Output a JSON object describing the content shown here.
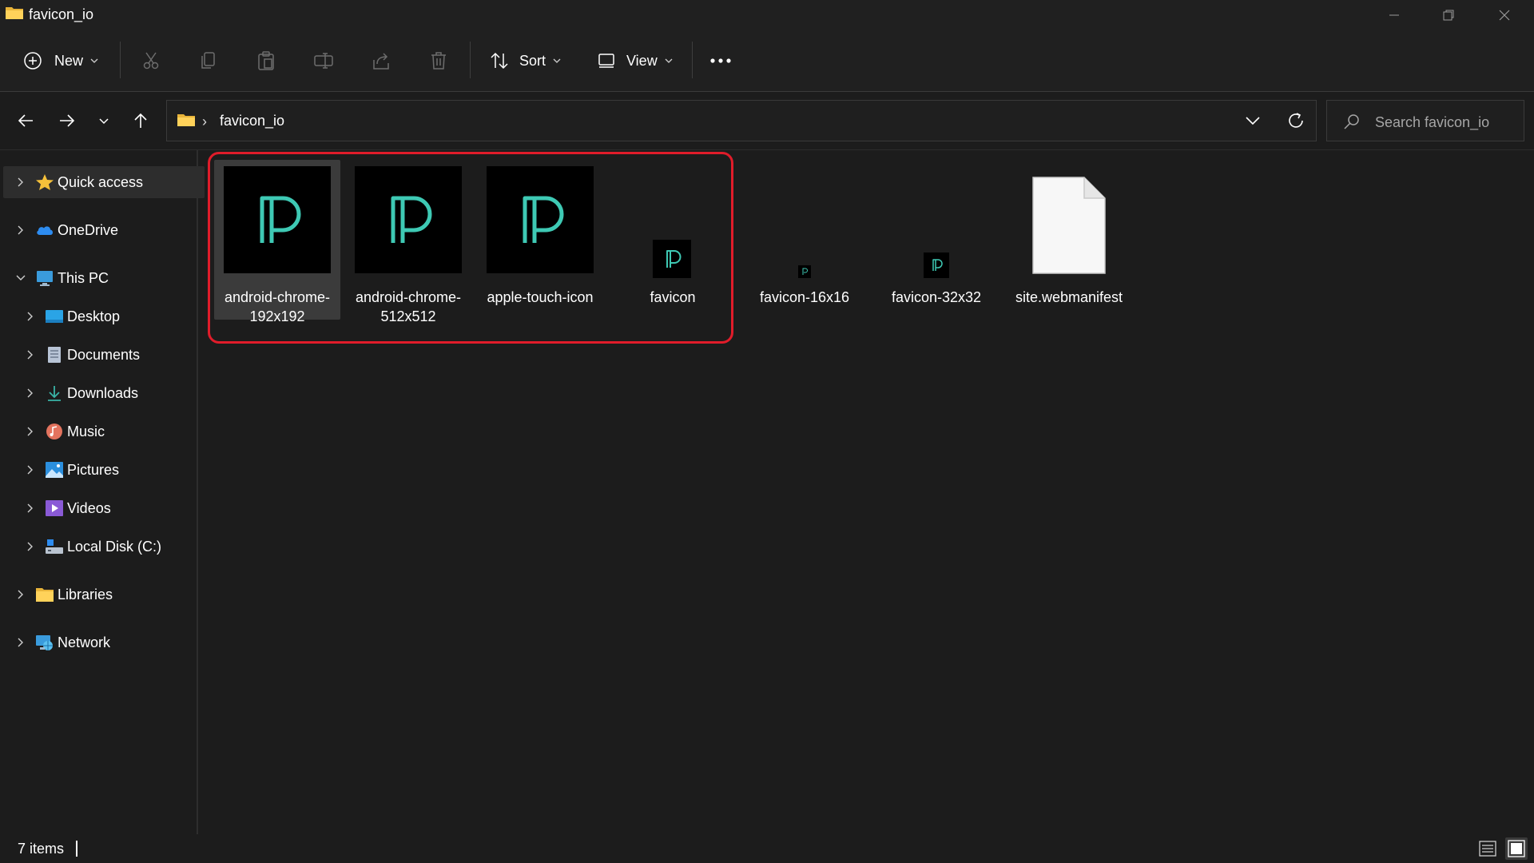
{
  "window": {
    "title": "favicon_io"
  },
  "toolbar": {
    "new_label": "New",
    "sort_label": "Sort",
    "view_label": "View"
  },
  "address": {
    "path": "favicon_io"
  },
  "search": {
    "placeholder": "Search favicon_io"
  },
  "sidebar": {
    "items": [
      {
        "label": "Quick access",
        "icon": "star-icon"
      },
      {
        "label": "OneDrive",
        "icon": "cloud-icon"
      },
      {
        "label": "This PC",
        "icon": "monitor-icon"
      },
      {
        "label": "Desktop",
        "icon": "desktop-icon"
      },
      {
        "label": "Documents",
        "icon": "document-icon"
      },
      {
        "label": "Downloads",
        "icon": "download-icon"
      },
      {
        "label": "Music",
        "icon": "music-icon"
      },
      {
        "label": "Pictures",
        "icon": "picture-icon"
      },
      {
        "label": "Videos",
        "icon": "video-icon"
      },
      {
        "label": "Local Disk (C:)",
        "icon": "disk-icon"
      },
      {
        "label": "Libraries",
        "icon": "folder-icon"
      },
      {
        "label": "Network",
        "icon": "network-icon"
      }
    ]
  },
  "files": [
    {
      "line1": "android-chrome-",
      "line2": "192x192"
    },
    {
      "line1": "android-chrome-",
      "line2": "512x512"
    },
    {
      "line1": "apple-touch-icon",
      "line2": ""
    },
    {
      "line1": "favicon",
      "line2": ""
    },
    {
      "line1": "favicon-16x16",
      "line2": ""
    },
    {
      "line1": "favicon-32x32",
      "line2": ""
    },
    {
      "line1": "site.webmanifest",
      "line2": ""
    }
  ],
  "status": {
    "items": "7 items"
  },
  "colors": {
    "accent_highlight": "#e01c2a",
    "logo_teal": "#3ec9b4"
  }
}
